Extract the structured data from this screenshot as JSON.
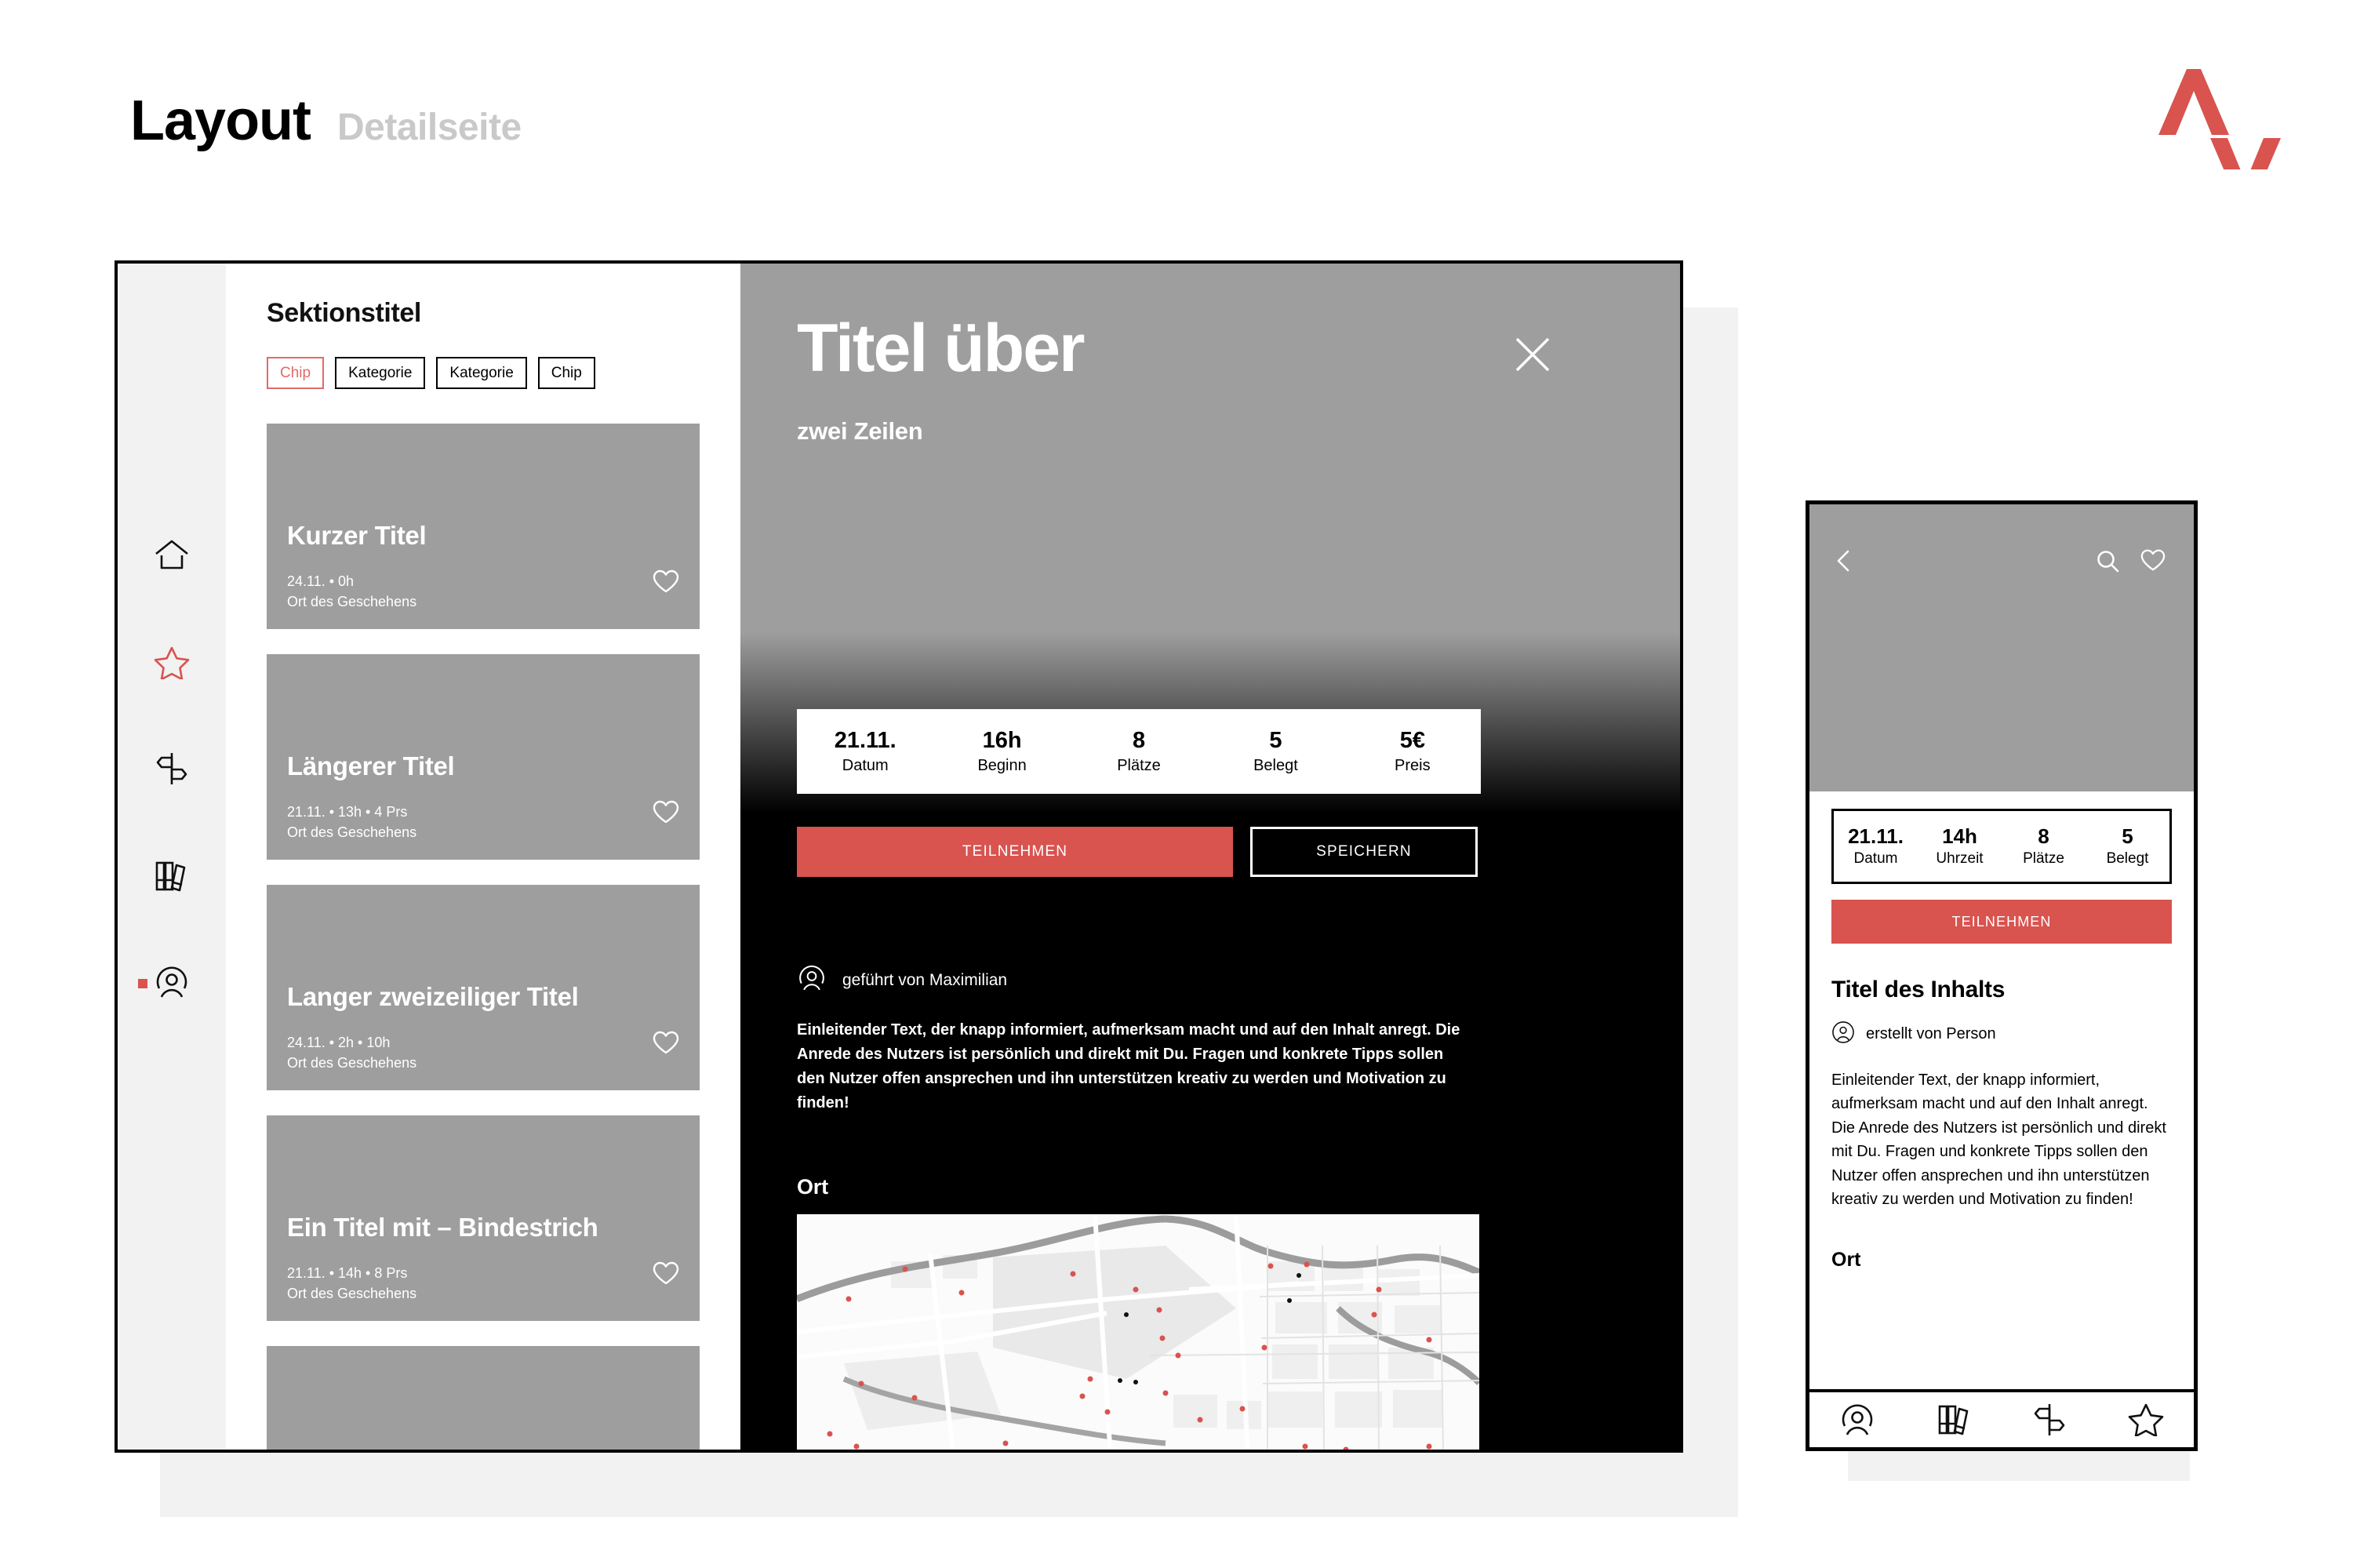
{
  "header": {
    "title": "Layout",
    "subtitle": "Detailseite",
    "logo_icon": "chevron-up-down-logo",
    "logo_color": "#d9534f"
  },
  "colors": {
    "accent": "#d9534f",
    "chip_active": "#e26a66",
    "placeholder_gray": "#9e9e9e",
    "rail_bg": "#f2f2f2",
    "shadow_plate": "#f2f2f2"
  },
  "desktop": {
    "rail": {
      "items": [
        {
          "icon": "home-icon",
          "active": false
        },
        {
          "icon": "star-icon",
          "active": true
        },
        {
          "icon": "signpost-icon",
          "active": false
        },
        {
          "icon": "books-icon",
          "active": false
        },
        {
          "icon": "user-circle-icon",
          "active": false,
          "indicator": true
        }
      ]
    },
    "list": {
      "section_title": "Sektionstitel",
      "chips": [
        {
          "label": "Chip",
          "active": true
        },
        {
          "label": "Kategorie",
          "active": false
        },
        {
          "label": "Kategorie",
          "active": false
        },
        {
          "label": "Chip",
          "active": false
        }
      ],
      "cards": [
        {
          "title": "Kurzer Titel",
          "meta": "24.11. • 0h",
          "place": "Ort des Geschehens",
          "heart": "heart-icon"
        },
        {
          "title": "Längerer Titel",
          "meta": "21.11. • 13h • 4 Prs",
          "place": "Ort des Geschehens",
          "heart": "heart-icon"
        },
        {
          "title": "Langer zweizeiliger Titel",
          "meta": "24.11. • 2h • 10h",
          "place": "Ort des Geschehens",
          "heart": "heart-icon"
        },
        {
          "title": "Ein Titel mit – Bindestrich",
          "meta": "21.11. • 14h • 8 Prs",
          "place": "Ort des Geschehens",
          "heart": "heart-icon"
        }
      ]
    },
    "detail": {
      "title": "Titel über",
      "subtitle": "zwei Zeilen",
      "close_icon": "close-icon",
      "stats": [
        {
          "value": "21.11.",
          "label": "Datum"
        },
        {
          "value": "16h",
          "label": "Beginn"
        },
        {
          "value": "8",
          "label": "Plätze"
        },
        {
          "value": "5",
          "label": "Belegt"
        },
        {
          "value": "5€",
          "label": "Preis"
        }
      ],
      "primary_button": "TEILNEHMEN",
      "secondary_button": "SPEICHERN",
      "author_icon": "user-circle-icon",
      "author": "geführt von Maximilian",
      "lead_text": "Einleitender Text, der knapp informiert, aufmerksam macht und auf den Inhalt anregt. Die Anrede des Nutzers ist persönlich und direkt mit Du. Fragen und konkrete Tipps sollen den Nutzer offen ansprechen und ihn unterstützen kreativ zu werden und Motivation zu finden!",
      "location_label": "Ort",
      "map_alt": "map-of-berlin-tiergarten"
    }
  },
  "phone": {
    "hero": {
      "back_icon": "chevron-left-icon",
      "search_icon": "search-icon",
      "heart_icon": "heart-icon"
    },
    "stats": [
      {
        "value": "21.11.",
        "label": "Datum"
      },
      {
        "value": "14h",
        "label": "Uhrzeit"
      },
      {
        "value": "8",
        "label": "Plätze"
      },
      {
        "value": "5",
        "label": "Belegt"
      }
    ],
    "primary_button": "TEILNEHMEN",
    "content_title": "Titel  des Inhalts",
    "author_icon": "user-circle-icon",
    "author": "erstellt von Person",
    "lead_text": "Einleitender Text, der knapp informiert, aufmerksam macht und auf den Inhalt anregt. Die Anrede des Nutzers ist persönlich und direkt mit Du. Fragen und konkrete Tipps sollen den Nutzer offen ansprechen und ihn unterstützen kreativ zu werden und Motivation zu finden!",
    "location_label": "Ort",
    "nav": [
      {
        "icon": "user-circle-icon"
      },
      {
        "icon": "books-icon"
      },
      {
        "icon": "signpost-icon"
      },
      {
        "icon": "star-icon"
      }
    ]
  }
}
